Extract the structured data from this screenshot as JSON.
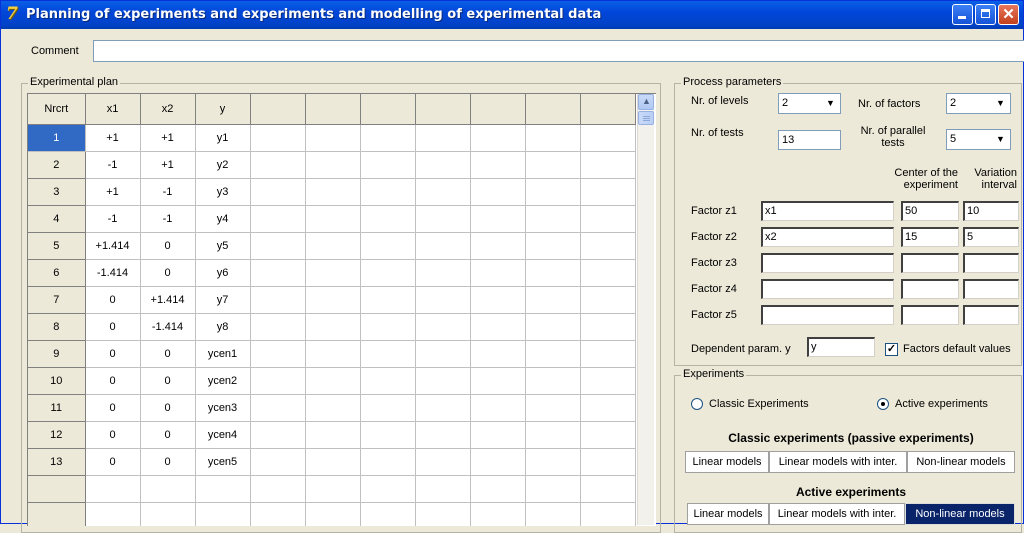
{
  "window": {
    "title": "Planning of experiments and experiments and modelling of experimental data",
    "icon": "7-logo-icon"
  },
  "comment": {
    "label": "Comment",
    "value": ""
  },
  "plan": {
    "title": "Experimental plan",
    "headers": [
      "Nrcrt",
      "x1",
      "x2",
      "y"
    ],
    "rows": [
      [
        "1",
        "+1",
        "+1",
        "y1"
      ],
      [
        "2",
        "-1",
        "+1",
        "y2"
      ],
      [
        "3",
        "+1",
        "-1",
        "y3"
      ],
      [
        "4",
        "-1",
        "-1",
        "y4"
      ],
      [
        "5",
        "+1.414",
        "0",
        "y5"
      ],
      [
        "6",
        "-1.414",
        "0",
        "y6"
      ],
      [
        "7",
        "0",
        "+1.414",
        "y7"
      ],
      [
        "8",
        "0",
        "-1.414",
        "y8"
      ],
      [
        "9",
        "0",
        "0",
        "ycen1"
      ],
      [
        "10",
        "0",
        "0",
        "ycen2"
      ],
      [
        "11",
        "0",
        "0",
        "ycen3"
      ],
      [
        "12",
        "0",
        "0",
        "ycen4"
      ],
      [
        "13",
        "0",
        "0",
        "ycen5"
      ],
      [
        "",
        "",
        "",
        ""
      ],
      [
        "",
        "",
        "",
        ""
      ]
    ]
  },
  "process": {
    "title": "Process parameters",
    "levels_label": "Nr. of levels",
    "levels_value": "2",
    "factors_label": "Nr. of factors",
    "factors_value": "2",
    "tests_label": "Nr. of tests",
    "tests_value": "13",
    "parallel_label_1": "Nr. of parallel",
    "parallel_label_2": "tests",
    "parallel_value": "5",
    "center_header_1": "Center of the",
    "center_header_2": "experiment",
    "interval_header_1": "Variation",
    "interval_header_2": "interval",
    "factors": [
      {
        "label": "Factor z1",
        "name": "x1",
        "center": "50",
        "interval": "10"
      },
      {
        "label": "Factor z2",
        "name": "x2",
        "center": "15",
        "interval": "5"
      },
      {
        "label": "Factor z3",
        "name": "",
        "center": "",
        "interval": ""
      },
      {
        "label": "Factor z4",
        "name": "",
        "center": "",
        "interval": ""
      },
      {
        "label": "Factor z5",
        "name": "",
        "center": "",
        "interval": ""
      }
    ],
    "dep_label": "Dependent param. y",
    "dep_value": "y",
    "defaults_label": "Factors default values",
    "defaults_checked": true
  },
  "experiments": {
    "title": "Experiments",
    "classic_radio": "Classic Experiments",
    "active_radio": "Active experiments",
    "selected": "active",
    "classic_heading": "Classic experiments (passive experiments)",
    "active_heading": "Active experiments",
    "classic_buttons": [
      "Linear models",
      "Linear models with inter.",
      "Non-linear models"
    ],
    "active_buttons": [
      "Linear models",
      "Linear models with inter.",
      "Non-linear models"
    ]
  }
}
